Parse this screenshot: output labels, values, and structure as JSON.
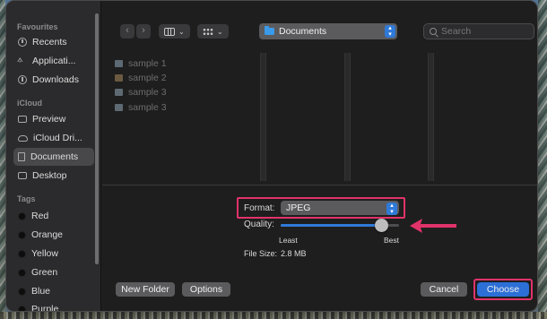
{
  "sidebar": {
    "favourites_label": "Favourites",
    "favourites": [
      {
        "label": "Recents",
        "icon": "clock-icon"
      },
      {
        "label": "Applicati...",
        "icon": "applications-icon"
      },
      {
        "label": "Downloads",
        "icon": "download-icon"
      }
    ],
    "icloud_label": "iCloud",
    "icloud": [
      {
        "label": "Preview",
        "icon": "folder-icon"
      },
      {
        "label": "iCloud Dri...",
        "icon": "cloud-icon"
      },
      {
        "label": "Documents",
        "icon": "document-icon",
        "selected": true
      },
      {
        "label": "Desktop",
        "icon": "desktop-icon"
      }
    ],
    "tags_label": "Tags",
    "tags": [
      {
        "label": "Red"
      },
      {
        "label": "Orange"
      },
      {
        "label": "Yellow"
      },
      {
        "label": "Green"
      },
      {
        "label": "Blue"
      },
      {
        "label": "Purple"
      }
    ]
  },
  "toolbar": {
    "back": "‹",
    "forward": "›",
    "location": "Documents",
    "search_placeholder": "Search"
  },
  "files": [
    {
      "name": "sample 1",
      "icon": "file-icon"
    },
    {
      "name": "sample 2",
      "icon": "image-file-icon"
    },
    {
      "name": "sample 3",
      "icon": "file-icon"
    },
    {
      "name": "sample 3",
      "icon": "file-icon"
    }
  ],
  "options": {
    "format_label": "Format:",
    "format_value": "JPEG",
    "quality_label": "Quality:",
    "quality_level": 0.85,
    "least": "Least",
    "best": "Best",
    "file_size_label": "File Size:",
    "file_size_value": "2.8 MB"
  },
  "buttons": {
    "new_folder": "New Folder",
    "options": "Options",
    "cancel": "Cancel",
    "choose": "Choose"
  },
  "colors": {
    "accent": "#2c6fd6",
    "highlight": "#e0336a"
  }
}
